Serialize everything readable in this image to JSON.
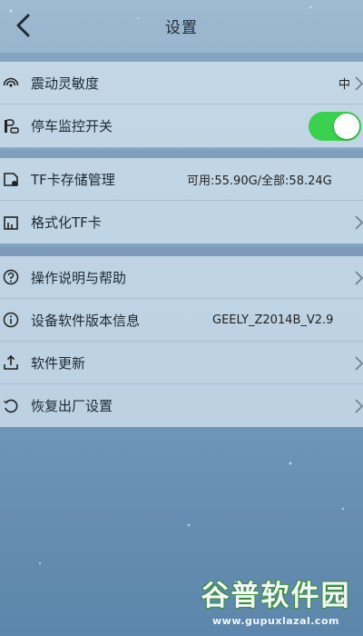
{
  "header": {
    "title": "设置"
  },
  "group1": [
    {
      "label": "震动灵敏度",
      "value": "中",
      "icon": "signal-icon",
      "chevron": true
    },
    {
      "label": "停车监控开关",
      "icon": "parking-icon",
      "toggle_on": true
    }
  ],
  "group2": [
    {
      "label": "TF卡存储管理",
      "value": "可用:55.90G/全部:58.24G",
      "icon": "sdcard-icon"
    },
    {
      "label": "格式化TF卡",
      "icon": "format-icon",
      "chevron": true
    }
  ],
  "group3": [
    {
      "label": "操作说明与帮助",
      "icon": "help-icon",
      "chevron": true
    },
    {
      "label": "设备软件版本信息",
      "value": "GEELY_Z2014B_V2.9",
      "icon": "info-icon"
    },
    {
      "label": "软件更新",
      "icon": "upload-icon",
      "chevron": true
    },
    {
      "label": "恢复出厂设置",
      "icon": "reset-icon",
      "chevron": true
    }
  ],
  "watermark": {
    "main": "谷普软件园",
    "sub": "www.gupuxlazal.com"
  },
  "colors": {
    "toggle_on": "#3ad14f",
    "row_bg": "#cddeec",
    "background": "#7fa3c2"
  }
}
